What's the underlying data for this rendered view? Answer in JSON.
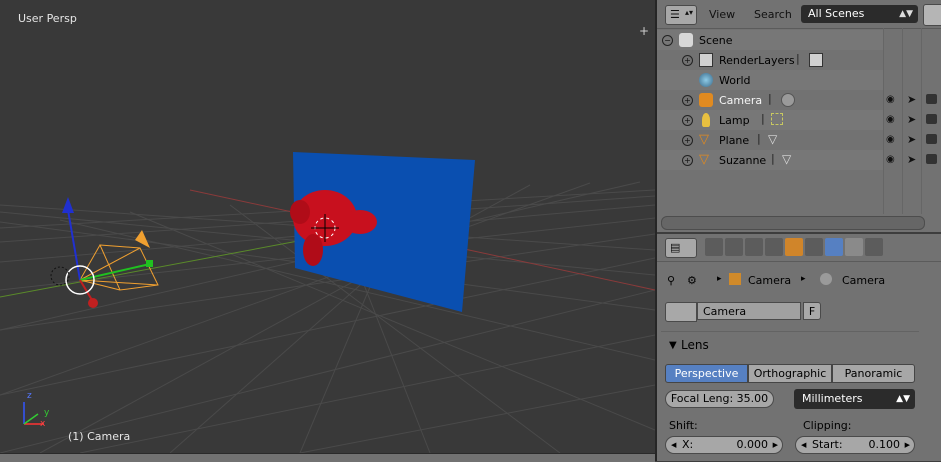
{
  "viewport": {
    "view_label": "User Persp",
    "object_label": "(1) Camera",
    "axis_x": "x",
    "axis_y": "y",
    "axis_z": "z"
  },
  "outliner": {
    "menu": [
      "View",
      "Search"
    ],
    "scene_select": "All Scenes",
    "rows": [
      {
        "name": "Scene"
      },
      {
        "name": "RenderLayers"
      },
      {
        "name": "World"
      },
      {
        "name": "Camera"
      },
      {
        "name": "Lamp"
      },
      {
        "name": "Plane"
      },
      {
        "name": "Suzanne"
      }
    ]
  },
  "properties": {
    "breadcrumb": [
      "Camera",
      "Camera"
    ],
    "data_name": "Camera",
    "fake_user": "F",
    "panel_title": "Lens",
    "lens_types": [
      "Perspective",
      "Orthographic",
      "Panoramic"
    ],
    "active_lens_type": "Perspective",
    "focal_length": "Focal Leng: 35.00",
    "lens_unit": "Millimeters",
    "shift_label": "Shift:",
    "shift_x_label": "X:",
    "shift_x_value": "0.000",
    "clipping_label": "Clipping:",
    "clip_start_label": "Start:",
    "clip_start_value": "0.100"
  },
  "colors": {
    "viewport_bg": "#393939",
    "panel_bg": "#727272",
    "selection_blue": "#5680c2",
    "plane_blue": "#0a4fb0",
    "suzanne_red": "#c8101e",
    "camera_orange": "#f0a030"
  }
}
